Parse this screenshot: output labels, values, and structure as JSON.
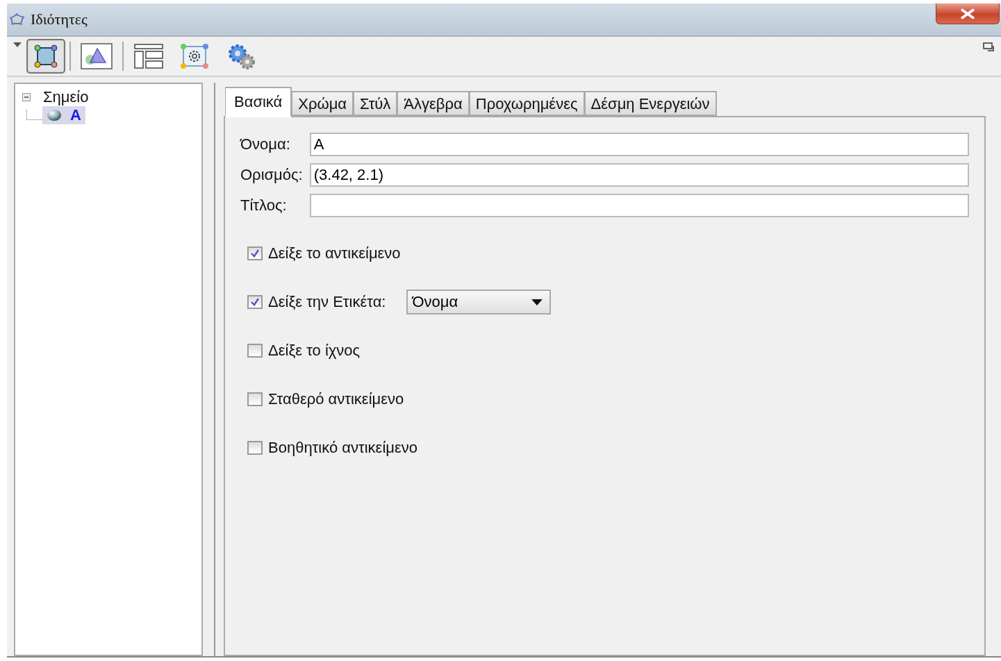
{
  "window": {
    "title": "Ιδιότητες"
  },
  "toolbar": {
    "buttons": [
      {
        "kind": "object-properties",
        "selected": true
      },
      {
        "kind": "graphics",
        "selected": false
      },
      {
        "kind": "layout",
        "selected": false
      },
      {
        "kind": "defaults",
        "selected": false
      },
      {
        "kind": "preferences",
        "selected": false
      }
    ]
  },
  "tree": {
    "items": [
      {
        "label": "Σημείο",
        "expanded": true,
        "children": [
          {
            "label": "A",
            "selected": true
          }
        ]
      }
    ]
  },
  "tabs": [
    {
      "label": "Βασικά",
      "selected": true
    },
    {
      "label": "Χρώμα",
      "selected": false
    },
    {
      "label": "Στύλ",
      "selected": false
    },
    {
      "label": "Άλγεβρα",
      "selected": false
    },
    {
      "label": "Προχωρημένες",
      "selected": false
    },
    {
      "label": "Δέσμη Ενεργειών",
      "selected": false
    }
  ],
  "fields": [
    {
      "label": "Όνομα:",
      "value": "A"
    },
    {
      "label": "Ορισμός:",
      "value": "(3.42, 2.1)"
    },
    {
      "label": "Τίτλος:"
    }
  ],
  "options": [
    {
      "kind": "checkbox",
      "label": "Δείξε το αντικείμενο",
      "checked": true
    },
    {
      "kind": "checkbox-dropdown",
      "label": "Δείξε την Ετικέτα:",
      "checked": true,
      "dropdown": "Όνομα"
    },
    {
      "kind": "checkbox",
      "label": "Δείξε το ίχνος",
      "checked": false
    },
    {
      "kind": "checkbox",
      "label": "Σταθερό αντικείμενο",
      "checked": false
    },
    {
      "kind": "checkbox",
      "label": "Βοηθητικό αντικείμενο",
      "checked": false
    }
  ]
}
